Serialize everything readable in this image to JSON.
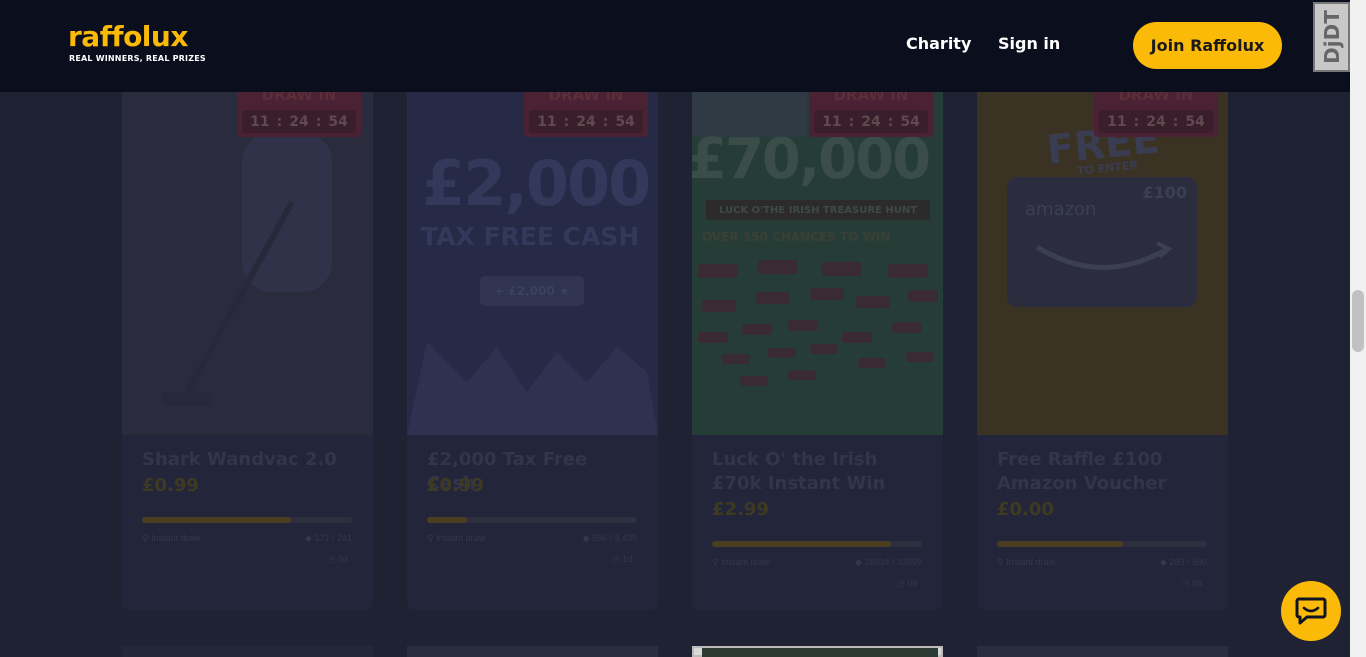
{
  "header": {
    "logo_text": "raffolux",
    "logo_tagline": "REAL WINNERS, REAL PRIZES",
    "nav": [
      {
        "label": "Charity"
      },
      {
        "label": "Sign in"
      }
    ],
    "cta_label": "Join Raffolux",
    "debug_toolbar_label": "DjDT"
  },
  "cards": [
    {
      "title": "Shark Wandvac 2.0",
      "price": "£0.99",
      "draw_label": "DRAW IN",
      "timer": [
        "11",
        "24",
        "54"
      ],
      "progress": 0.71,
      "tag_left": "Instant draw",
      "tag_right": "171 / 241",
      "time_left": "0d"
    },
    {
      "title": "£2,000 Tax Free Cash",
      "price": "£0.99",
      "draw_label": "DRAW IN",
      "timer": [
        "11",
        "24",
        "54"
      ],
      "progress": 0.19,
      "tag_left": "Instant draw",
      "tag_right": "656 / 3,499",
      "time_left": "1d",
      "art_big": "£2,000",
      "art_sub": "TAX FREE CASH",
      "art_pill": "+ £2,000 ★"
    },
    {
      "title": "Luck O' the Irish £70k Instant Win",
      "price": "£2.99",
      "draw_label": "DRAW IN",
      "timer": [
        "11",
        "24",
        "54"
      ],
      "progress": 0.85,
      "tag_left": "Instant draw",
      "tag_right": "28934 / 33999",
      "time_left": "0d",
      "art_big": "£70,000",
      "art_band": "LUCK O'THE IRISH TREASURE HUNT",
      "art_sub": "OVER 350 CHANCES TO WIN"
    },
    {
      "title": "Free Raffle £100 Amazon Voucher",
      "price": "£0.00",
      "draw_label": "DRAW IN",
      "timer": [
        "11",
        "24",
        "54"
      ],
      "progress": 0.6,
      "tag_left": "Instant draw",
      "tag_right": "289 / 500",
      "time_left": "0d",
      "art_big": "FREE",
      "art_small": "TO ENTER",
      "art_brand": "amazon",
      "art_amount": "£100"
    }
  ],
  "colors": {
    "brand_yellow": "#fbb908",
    "header_bg": "#0b0e1c",
    "overlay_bg": "#1f2233"
  },
  "chat_icon": "chat-bubble-icon"
}
